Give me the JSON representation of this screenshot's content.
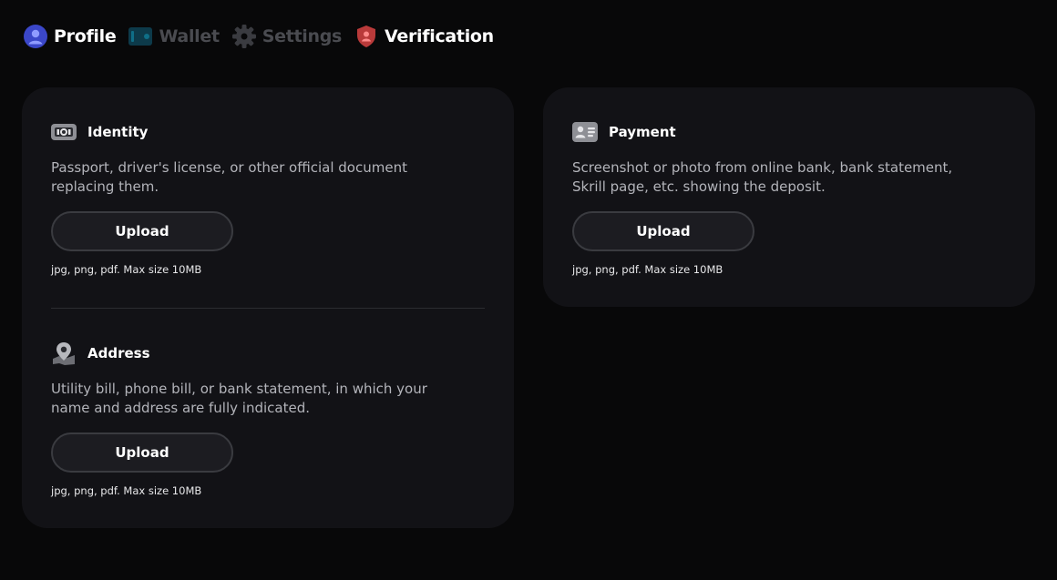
{
  "nav": {
    "items": [
      {
        "label": "Profile",
        "icon": "user-icon",
        "state": "active"
      },
      {
        "label": "Wallet",
        "icon": "wallet-icon",
        "state": "dim"
      },
      {
        "label": "Settings",
        "icon": "gear-icon",
        "state": "dim"
      },
      {
        "label": "Verification",
        "icon": "shield-user-icon",
        "state": "active"
      }
    ]
  },
  "sections": {
    "identity": {
      "title": "Identity",
      "icon": "id-card-icon",
      "description": "Passport, driver's license, or other official document replacing them.",
      "button": "Upload",
      "hint": "jpg, png, pdf. Max size 10MB"
    },
    "address": {
      "title": "Address",
      "icon": "map-pin-icon",
      "description": "Utility bill, phone bill, or bank statement, in which your name and address are fully indicated.",
      "button": "Upload",
      "hint": "jpg, png, pdf. Max size 10MB"
    },
    "payment": {
      "title": "Payment",
      "icon": "contact-card-icon",
      "description": "Screenshot or photo from online bank, bank statement, Skrill page, etc. showing the deposit.",
      "button": "Upload",
      "hint": "jpg, png, pdf. Max size 10MB"
    }
  },
  "colors": {
    "background": "#080809",
    "card": "#121216",
    "profile_icon": "#3b47c9",
    "wallet_icon": "#0d3a4a",
    "verification_icon": "#b93a3a"
  }
}
